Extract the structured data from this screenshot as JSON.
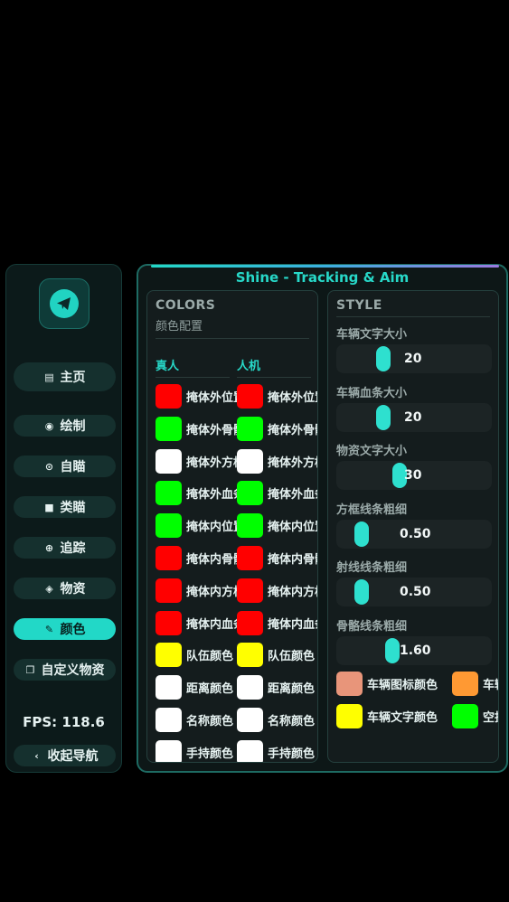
{
  "sidebar": {
    "logo_icon": "telegram-paper-plane-icon",
    "items": [
      {
        "label": "主页",
        "icon": "clipboard-icon",
        "glyph": "▤",
        "active": false
      },
      {
        "label": "绘制",
        "icon": "eye-icon",
        "glyph": "◉",
        "active": false
      },
      {
        "label": "自瞄",
        "icon": "target-icon",
        "glyph": "⊙",
        "active": false
      },
      {
        "label": "类瞄",
        "icon": "lock-icon",
        "glyph": "■",
        "active": false
      },
      {
        "label": "追踪",
        "icon": "crosshair-icon",
        "glyph": "⊕",
        "active": false
      },
      {
        "label": "物资",
        "icon": "box-icon",
        "glyph": "◈",
        "active": false
      },
      {
        "label": "颜色",
        "icon": "eyedropper-icon",
        "glyph": "✎",
        "active": true
      },
      {
        "label": "自定义物资",
        "icon": "copy-icon",
        "glyph": "❐",
        "active": false
      }
    ],
    "fps": "FPS: 118.6",
    "collapse_label": "收起导航",
    "collapse_icon": "chevron-left-icon",
    "accent": "#22d8c7"
  },
  "panel": {
    "title": "Shine - Tracking & Aim"
  },
  "colors": {
    "title": "COLORS",
    "subtitle": "颜色配置",
    "col_real": "真人",
    "col_bot": "人机",
    "real": [
      {
        "label": "掩体外位置",
        "color": "#ff0000"
      },
      {
        "label": "掩体外骨骼",
        "color": "#00ff00"
      },
      {
        "label": "掩体外方框",
        "color": "#ffffff"
      },
      {
        "label": "掩体外血条",
        "color": "#00ff00"
      },
      {
        "label": "掩体内位置",
        "color": "#00ff00"
      },
      {
        "label": "掩体内骨骼",
        "color": "#ff0000"
      },
      {
        "label": "掩体内方框",
        "color": "#ff0000"
      },
      {
        "label": "掩体内血条",
        "color": "#ff0000"
      },
      {
        "label": "队伍颜色",
        "color": "#ffff00"
      },
      {
        "label": "距离颜色",
        "color": "#ffffff"
      },
      {
        "label": "名称颜色",
        "color": "#ffffff"
      },
      {
        "label": "手持颜色",
        "color": "#ffffff"
      }
    ],
    "bot": [
      {
        "label": "掩体外位置",
        "color": "#ff0000"
      },
      {
        "label": "掩体外骨骼",
        "color": "#00ff00"
      },
      {
        "label": "掩体外方框",
        "color": "#ffffff"
      },
      {
        "label": "掩体外血条",
        "color": "#00ff00"
      },
      {
        "label": "掩体内位置",
        "color": "#00ff00"
      },
      {
        "label": "掩体内骨骼",
        "color": "#ff0000"
      },
      {
        "label": "掩体内方框",
        "color": "#ff0000"
      },
      {
        "label": "掩体内血条",
        "color": "#ff0000"
      },
      {
        "label": "队伍颜色",
        "color": "#ffff00"
      },
      {
        "label": "距离颜色",
        "color": "#ffffff"
      },
      {
        "label": "名称颜色",
        "color": "#ffffff"
      },
      {
        "label": "手持颜色",
        "color": "#ffffff"
      }
    ]
  },
  "style": {
    "title": "STYLE",
    "sliders": [
      {
        "label": "车辆文字大小",
        "value": "20",
        "level": 0.3
      },
      {
        "label": "车辆血条大小",
        "value": "20",
        "level": 0.3
      },
      {
        "label": "物资文字大小",
        "value": "30",
        "level": 0.45
      },
      {
        "label": "方框线条粗细",
        "value": "0.50",
        "level": 0.1
      },
      {
        "label": "射线线条粗细",
        "value": "0.50",
        "level": 0.1
      },
      {
        "label": "骨骼线条粗细",
        "value": "1.60",
        "level": 0.38
      }
    ],
    "vehicle_colors": [
      {
        "label": "车辆图标颜色",
        "color": "#e8957a"
      },
      {
        "label": "车辆血条颜色",
        "color": "#ff9933"
      },
      {
        "label": "车辆文字颜色",
        "color": "#ffff00"
      },
      {
        "label": "空投颜色",
        "color": "#00ff00"
      }
    ]
  }
}
